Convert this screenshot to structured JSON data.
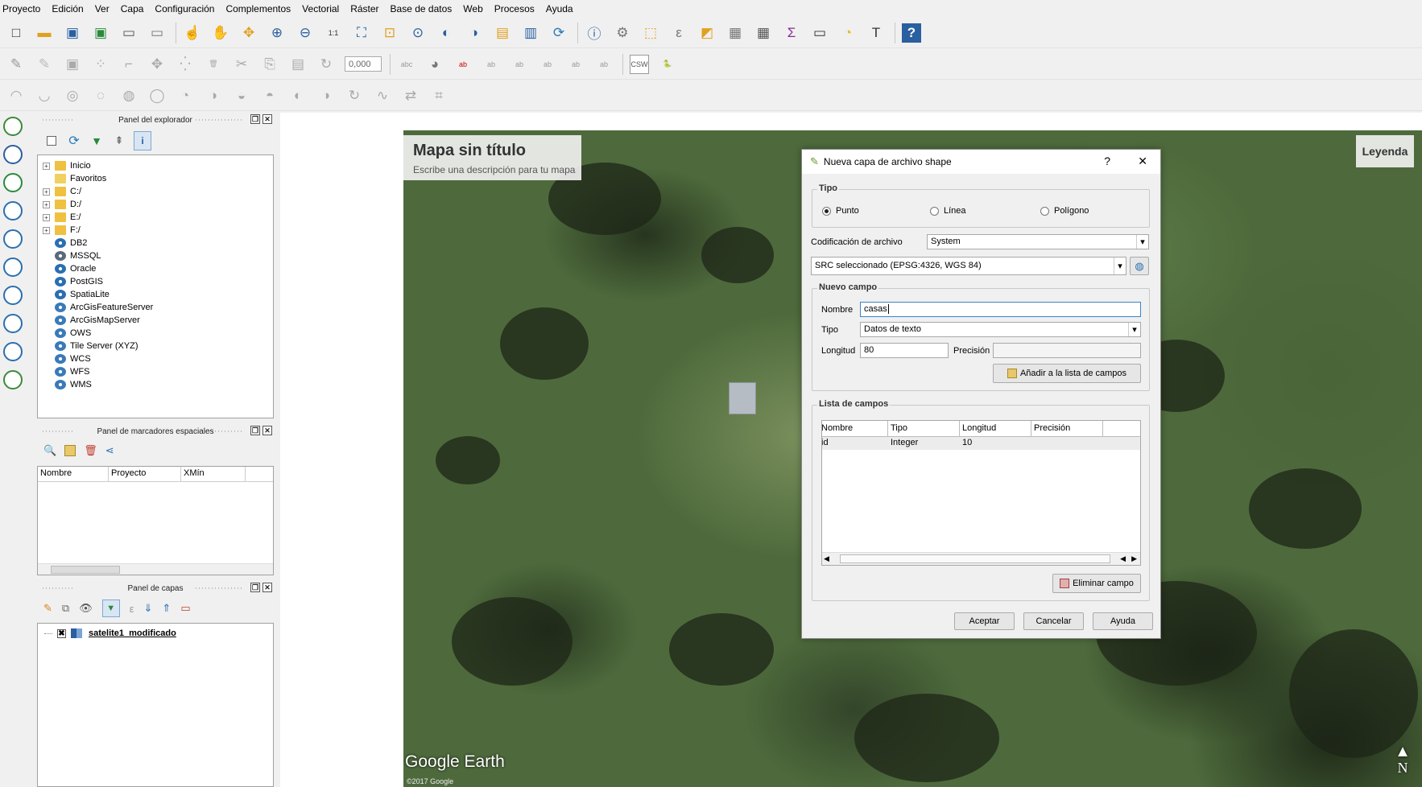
{
  "menu": [
    "Proyecto",
    "Edición",
    "Ver",
    "Capa",
    "Configuración",
    "Complementos",
    "Vectorial",
    "Ráster",
    "Base de datos",
    "Web",
    "Procesos",
    "Ayuda"
  ],
  "toolbar": {
    "scale_value": "0,000",
    "csw_label": "CSW"
  },
  "browser": {
    "title": "Panel del explorador",
    "items": [
      "Inicio",
      "Favoritos",
      "C:/",
      "D:/",
      "E:/",
      "F:/",
      "DB2",
      "MSSQL",
      "Oracle",
      "PostGIS",
      "SpatiaLite",
      "ArcGisFeatureServer",
      "ArcGisMapServer",
      "OWS",
      "Tile Server (XYZ)",
      "WCS",
      "WFS",
      "WMS"
    ]
  },
  "bookmarks": {
    "title": "Panel de marcadores espaciales",
    "columns": [
      "Nombre",
      "Proyecto",
      "XMín"
    ]
  },
  "layers": {
    "title": "Panel de capas",
    "layer_name": "satelite1_modificado"
  },
  "map": {
    "title": "Mapa sin título",
    "description": "Escribe una descripción para tu mapa",
    "legend": "Leyenda",
    "attribution": "Google Earth",
    "copyright": "©2017 Google",
    "north": "N"
  },
  "dialog": {
    "title": "Nueva capa de archivo shape",
    "help": "?",
    "close": "✕",
    "tipo": {
      "legend": "Tipo",
      "options": [
        "Punto",
        "Línea",
        "Polígono"
      ],
      "selected": "Punto"
    },
    "encoding_label": "Codificación de archivo",
    "encoding_value": "System",
    "crs_value": "SRC seleccionado (EPSG:4326, WGS 84)",
    "new_field": {
      "legend": "Nuevo campo",
      "name_label": "Nombre",
      "name_value": "casas",
      "type_label": "Tipo",
      "type_value": "Datos de texto",
      "length_label": "Longitud",
      "length_value": "80",
      "precision_label": "Precisión",
      "precision_value": "",
      "add_button": "Añadir a la lista de campos"
    },
    "field_list": {
      "legend": "Lista de campos",
      "columns": [
        "Nombre",
        "Tipo",
        "Longitud",
        "Precisión"
      ],
      "rows": [
        [
          "id",
          "Integer",
          "10",
          ""
        ]
      ],
      "remove_button": "Eliminar campo"
    },
    "accept": "Aceptar",
    "cancel": "Cancelar",
    "help_button": "Ayuda"
  }
}
